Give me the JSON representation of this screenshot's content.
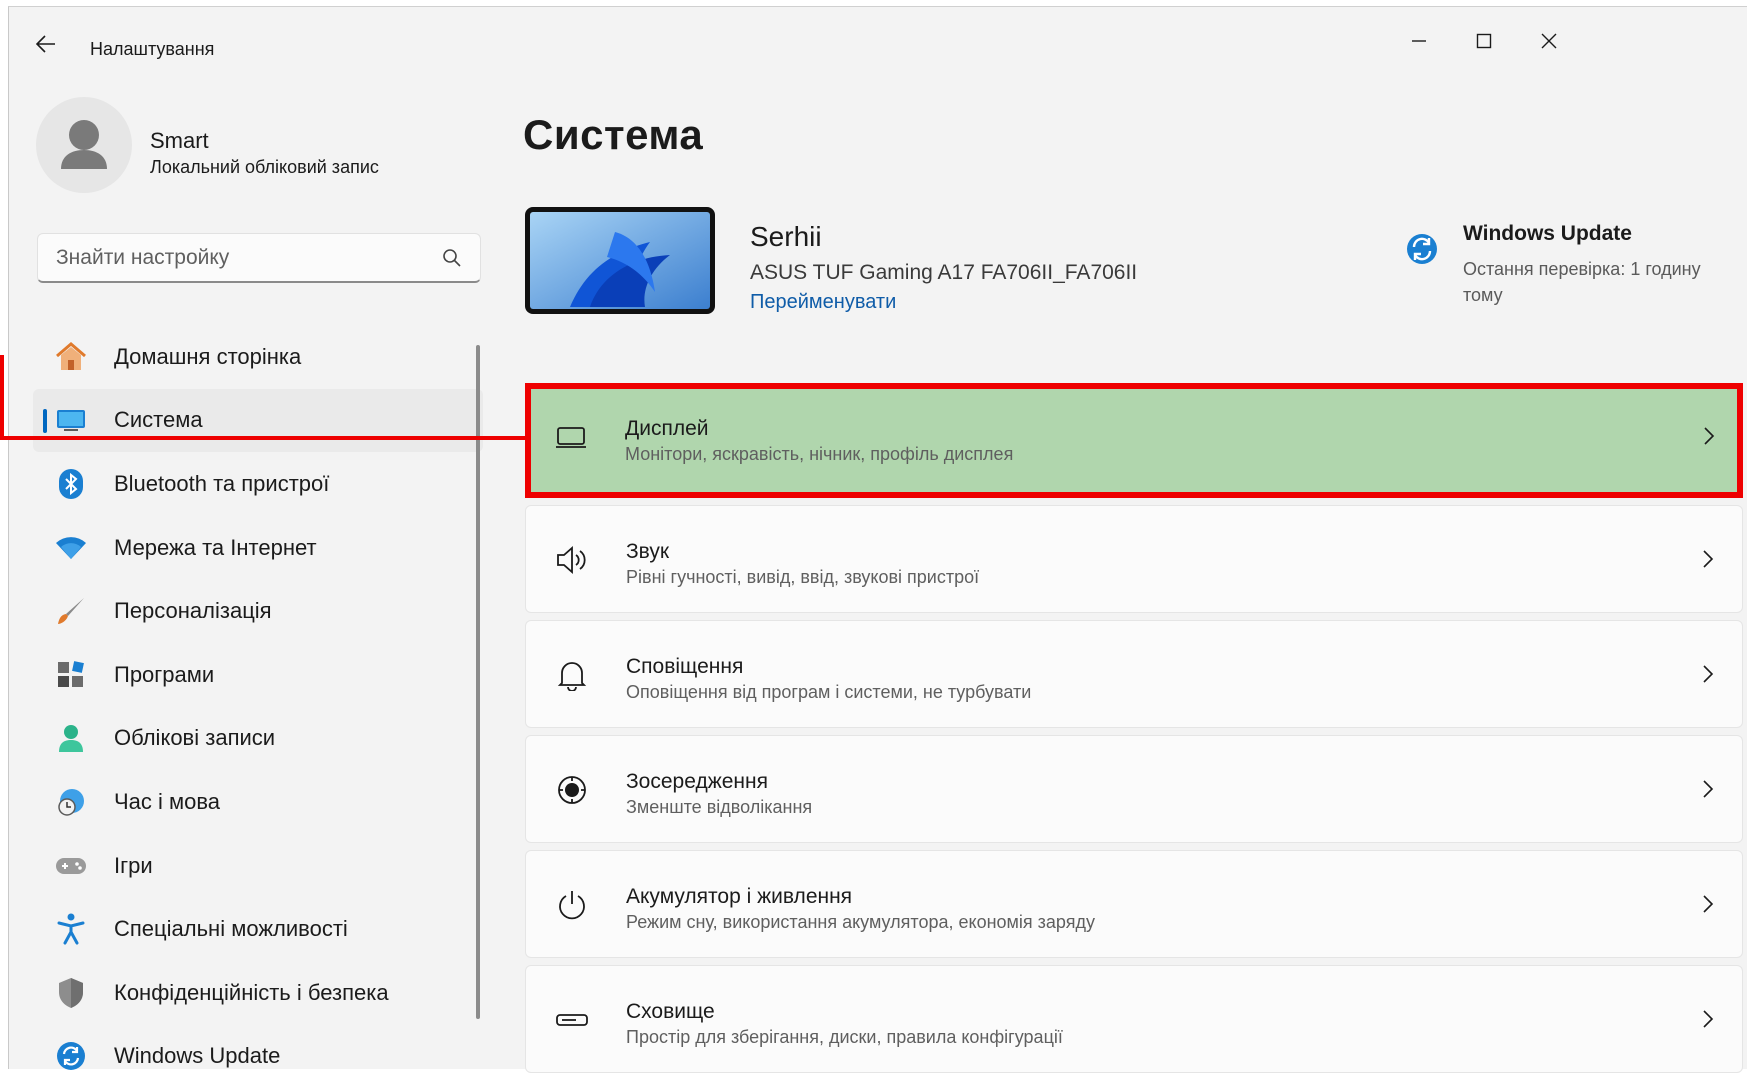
{
  "app": {
    "title": "Налаштування"
  },
  "user": {
    "name": "Smart",
    "account_type": "Локальний обліковий запис"
  },
  "search": {
    "placeholder": "Знайти настройку"
  },
  "sidebar": {
    "items": [
      {
        "label": "Домашня сторінка",
        "icon": "home-icon"
      },
      {
        "label": "Система",
        "icon": "system-icon",
        "active": true
      },
      {
        "label": "Bluetooth та пристрої",
        "icon": "bluetooth-icon"
      },
      {
        "label": "Мережа та Інтернет",
        "icon": "wifi-icon"
      },
      {
        "label": "Персоналізація",
        "icon": "brush-icon"
      },
      {
        "label": "Програми",
        "icon": "apps-icon"
      },
      {
        "label": "Облікові записи",
        "icon": "accounts-icon"
      },
      {
        "label": "Час і мова",
        "icon": "time-language-icon"
      },
      {
        "label": "Ігри",
        "icon": "gaming-icon"
      },
      {
        "label": "Спеціальні можливості",
        "icon": "accessibility-icon"
      },
      {
        "label": "Конфіденційність і безпека",
        "icon": "shield-icon"
      },
      {
        "label": "Windows Update",
        "icon": "windows-update-icon"
      }
    ]
  },
  "main": {
    "title": "Система",
    "device": {
      "name": "Serhii",
      "model": "ASUS TUF Gaming A17 FA706II_FA706II",
      "rename_link": "Перейменувати"
    },
    "windows_update": {
      "title": "Windows Update",
      "status": "Остання перевірка: 1 годину тому"
    },
    "cards": [
      {
        "title": "Дисплей",
        "description": "Монітори, яскравість, нічник, профіль дисплея",
        "icon": "display-icon",
        "highlighted": true
      },
      {
        "title": "Звук",
        "description": "Рівні гучності, вивід, ввід, звукові пристрої",
        "icon": "sound-icon"
      },
      {
        "title": "Сповіщення",
        "description": "Оповіщення від програм і системи, не турбувати",
        "icon": "bell-icon"
      },
      {
        "title": "Зосередження",
        "description": "Зменште відволікання",
        "icon": "focus-icon"
      },
      {
        "title": "Акумулятор і живлення",
        "description": "Режим сну, використання акумулятора, економія заряду",
        "icon": "power-icon"
      },
      {
        "title": "Сховище",
        "description": "Простір для зберігання, диски, правила конфігурації",
        "icon": "storage-icon"
      }
    ]
  },
  "colors": {
    "accent": "#0067c0",
    "highlight_fill": "#b0d6ad",
    "highlight_border": "#ee0000",
    "link": "#0f5ca8"
  }
}
